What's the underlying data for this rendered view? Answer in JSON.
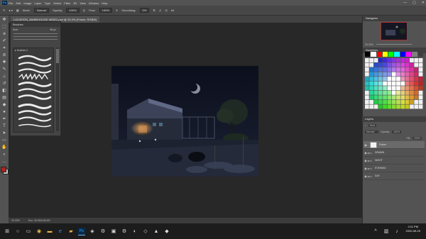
{
  "menu": {
    "app_icon": "Ps",
    "items": [
      "File",
      "Edit",
      "Image",
      "Layer",
      "Type",
      "Select",
      "Filter",
      "3D",
      "View",
      "Window",
      "Help"
    ],
    "window_controls": [
      "—",
      "▢",
      "✕"
    ]
  },
  "options": {
    "brush_size": "",
    "mode_label": "Mode:",
    "mode_value": "Normal",
    "opacity_label": "Opacity:",
    "opacity_value": "100%",
    "flow_label": "Flow:",
    "flow_value": "100%",
    "smoothing_label": "Smoothing:",
    "smoothing_value": "0%"
  },
  "document": {
    "tab_title": "LOCATION_WAREHOUSE WIDE2.psd @ 33.3% (Frame, RGB/8)",
    "zoom": "33.33%",
    "doc_info": "Doc: 30.9M/145.4M"
  },
  "brushes_panel": {
    "title": "Brushes",
    "size_label": "Size:",
    "size_value": "50 px",
    "group_name": "brushes 2",
    "scroll_icon": "scrollbar"
  },
  "navigator": {
    "title": "Navigator",
    "zoom": "33.33%"
  },
  "swatches": {
    "title": "Swatches",
    "strip_colors": [
      "#000000",
      "#ffffff",
      "#ff0000",
      "#ffff00",
      "#00ff00",
      "#00ffff",
      "#0000ff",
      "#ff00ff",
      "#7f7f7f",
      "#3f3f3f"
    ]
  },
  "layers": {
    "title": "Layers",
    "kind_label": "Kind",
    "blend_mode": "Normal",
    "opacity_label": "Opacity:",
    "opacity_value": "100%",
    "fill_label": "Fill:",
    "fill_value": "100%",
    "items": [
      {
        "name": "Frame",
        "selected": true,
        "type": "layer"
      },
      {
        "name": "DRAWN",
        "selected": false,
        "type": "group"
      },
      {
        "name": "NIGHT",
        "selected": false,
        "type": "group"
      },
      {
        "name": "EVENING",
        "selected": false,
        "type": "group"
      },
      {
        "name": "DAY",
        "selected": false,
        "type": "group"
      }
    ]
  },
  "tools": [
    "move-icon",
    "marquee-icon",
    "lasso-icon",
    "quick-select-icon",
    "crop-icon",
    "eyedropper-icon",
    "healing-icon",
    "brush-icon",
    "stamp-icon",
    "history-brush-icon",
    "eraser-icon",
    "gradient-icon",
    "blur-icon",
    "dodge-icon",
    "pen-icon",
    "type-icon",
    "path-select-icon",
    "rectangle-icon",
    "hand-icon",
    "zoom-icon"
  ],
  "taskbar": {
    "apps": [
      "windows-icon",
      "search-icon",
      "task-view-icon",
      "chrome-icon",
      "file-explorer-icon",
      "edge-icon",
      "folder-icon",
      "photoshop-icon",
      "app-icon",
      "steam-icon",
      "app-icon",
      "steam-icon",
      "app-icon",
      "app-icon",
      "app-icon",
      "app-icon"
    ],
    "time": "2:11 PM",
    "date": "2020-05-29"
  }
}
